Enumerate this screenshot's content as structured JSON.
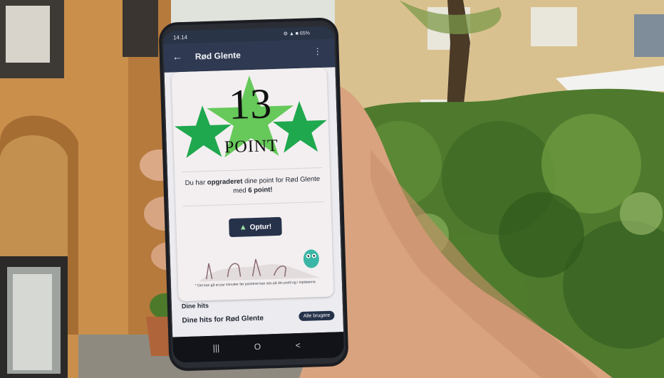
{
  "phone": {
    "status_time": "14.14",
    "status_icons": "⚙ ▲ ■ 65%",
    "app_title": "Rød Glente",
    "dialog": {
      "points_number": "13",
      "points_word": "POINT",
      "message_start": "Du har ",
      "message_bold1": "opgraderet",
      "message_mid": " dine point for Rød Glente med ",
      "message_bold2": "6 point!",
      "button_label": "Optur!",
      "footnote": "* Det kan gå et par minutter før pointene kan ses på din profil og i toplisterne."
    },
    "below": {
      "row1": "Dine hits",
      "row2": "Dine hits for Rød Glente",
      "all_users_button": "Alle brugere"
    },
    "nav": {
      "recent": "|||",
      "home": "O",
      "back": "<"
    }
  },
  "colors": {
    "star_green": "#1fa84e",
    "star_green_light": "#66c95a",
    "app_bar": "#2f3a52",
    "button": "#26324a",
    "dialog_bg": "#f3eff0"
  }
}
